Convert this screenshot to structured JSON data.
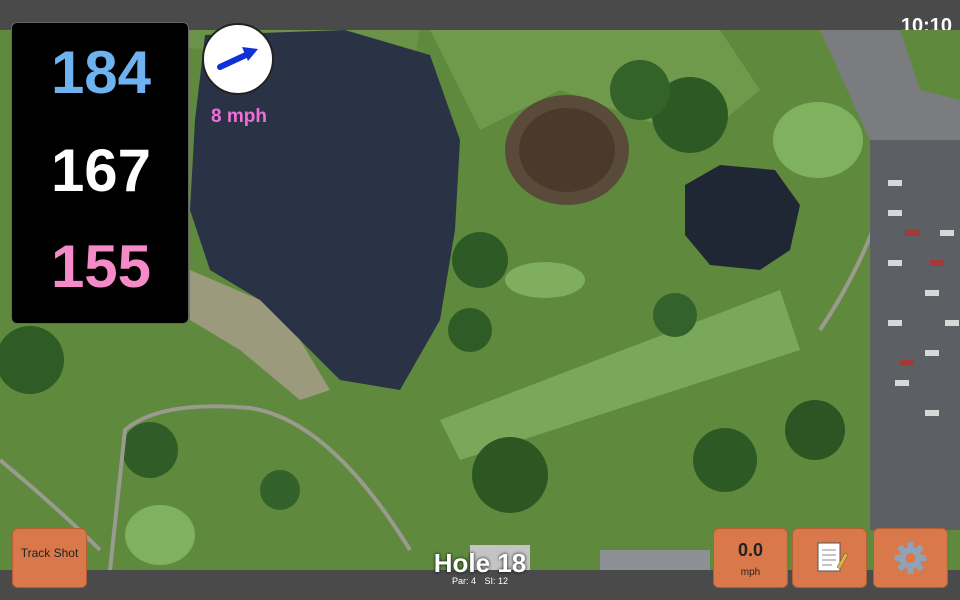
{
  "status": {
    "time": "10:10"
  },
  "distances": {
    "back": "184",
    "middle": "167",
    "front": "155"
  },
  "wind": {
    "speed": "8 mph",
    "direction_icon": "arrow-right-up-icon"
  },
  "hole": {
    "title": "Hole 18",
    "par": "Par: 4",
    "si": "SI: 12"
  },
  "buttons": {
    "track_shot": "Track Shot",
    "speed_value": "0.0",
    "speed_unit": "mph",
    "notes_icon": "notepad-icon",
    "settings_icon": "gear-icon"
  },
  "colors": {
    "back": "#6eb3f0",
    "middle": "#ffffff",
    "front": "#f48ac8",
    "wind_speed": "#f06ed8",
    "button": "#d9784a"
  }
}
